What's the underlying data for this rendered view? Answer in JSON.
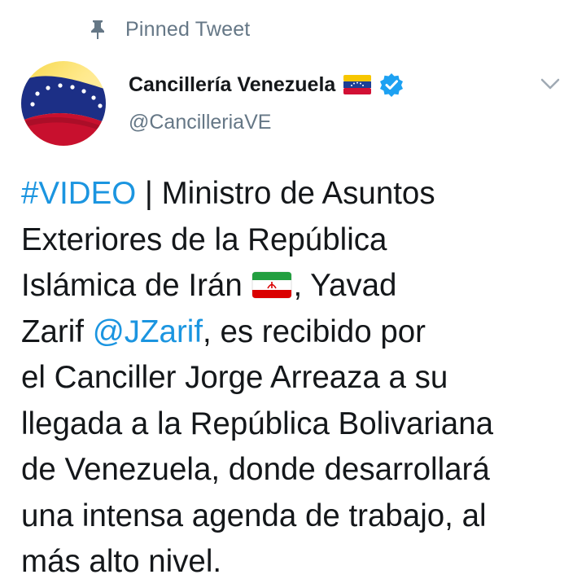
{
  "pinned": {
    "label": "Pinned Tweet",
    "icon": "pin-icon"
  },
  "author": {
    "name": "Cancillería Venezuela",
    "handle": "@CancilleriaVE",
    "name_flag_icon": "venezuela-flag-icon",
    "verified": true
  },
  "menu": {
    "icon": "chevron-down-icon"
  },
  "tweet": {
    "hashtag": "#VIDEO",
    "text_1": " | Ministro de Asuntos",
    "text_2": "Exteriores de la República",
    "text_3a": "Islámica de Irán ",
    "flag_icon": "iran-flag-icon",
    "text_3b": ", Yavad",
    "text_4a": "Zarif ",
    "mention": "@JZarif",
    "text_4b": ", es recibido por",
    "text_5": "el Canciller Jorge Arreaza a su",
    "text_6": "llegada a la República Bolivariana",
    "text_7": "de Venezuela, donde desarrollará",
    "text_8": "una intensa agenda de trabajo, al",
    "text_9": "más alto nivel."
  },
  "colors": {
    "link": "#1b95e0",
    "secondary_text": "#657786",
    "primary_text": "#14171a",
    "verified_badge": "#1da1f2"
  }
}
